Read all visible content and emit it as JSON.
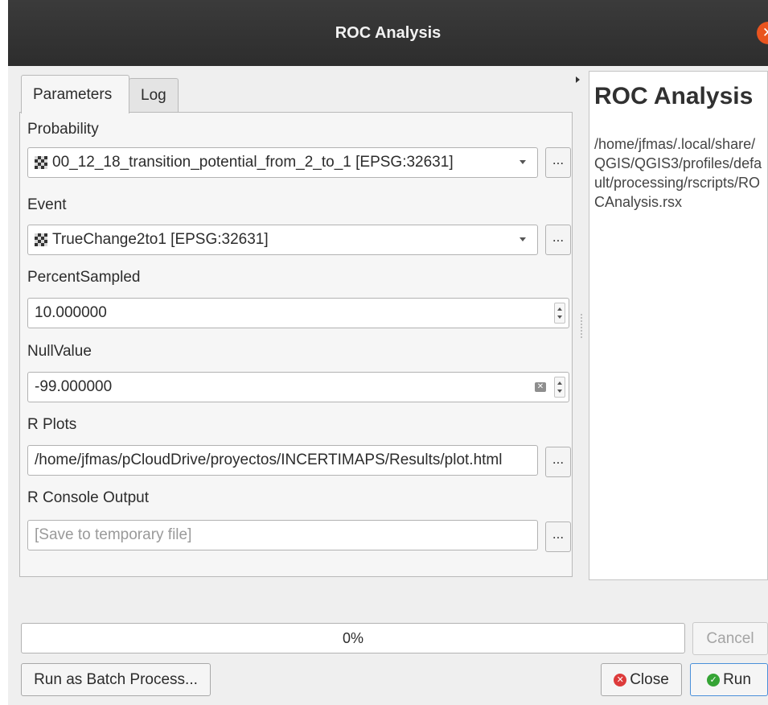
{
  "window": {
    "title": "ROC Analysis"
  },
  "tabs": [
    {
      "label": "Parameters"
    },
    {
      "label": "Log"
    }
  ],
  "parameters": {
    "probability": {
      "label": "Probability",
      "value": "00_12_18_transition_potential_from_2_to_1 [EPSG:32631]"
    },
    "event": {
      "label": "Event",
      "value": "TrueChange2to1 [EPSG:32631]"
    },
    "percent_sampled": {
      "label": "PercentSampled",
      "value": "10.000000"
    },
    "null_value": {
      "label": "NullValue",
      "value": "-99.000000"
    },
    "r_plots": {
      "label": "R Plots",
      "value": "/home/jfmas/pCloudDrive/proyectos/INCERTIMAPS/Results/plot.html"
    },
    "r_console_output": {
      "label": "R Console Output",
      "placeholder": "[Save to temporary file]"
    },
    "browse_label": "..."
  },
  "help": {
    "title": "ROC Analysis",
    "path": "/home/jfmas/.local/share/QGIS/QGIS3/profiles/default/processing/rscripts/ROCAnalysis.rsx"
  },
  "progress": {
    "text": "0%"
  },
  "buttons": {
    "cancel": "Cancel",
    "batch": "Run as Batch Process...",
    "close": "Close",
    "run": "Run"
  },
  "icons": {
    "close_window": "close-icon",
    "raster_layer": "raster-layer-icon",
    "clear": "clear-icon",
    "close_button": "close-circle-icon",
    "run_button": "check-circle-icon"
  }
}
